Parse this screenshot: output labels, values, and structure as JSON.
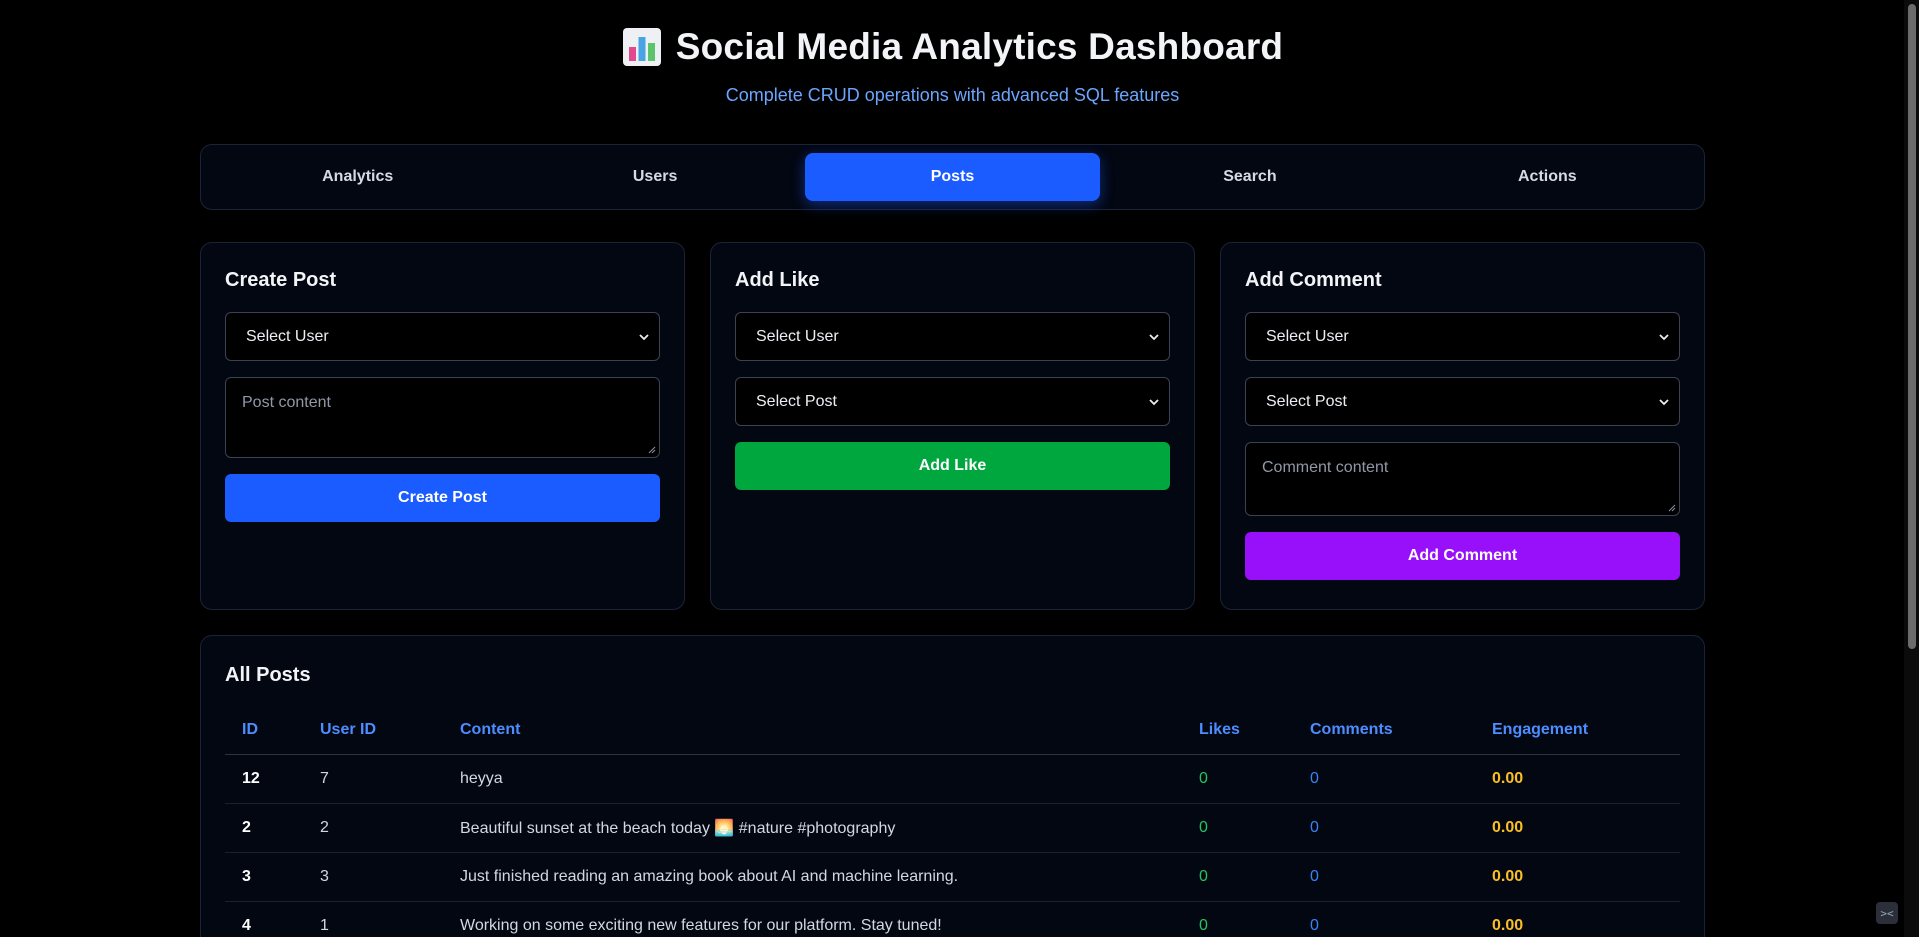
{
  "header": {
    "title": "Social Media Analytics Dashboard",
    "subtitle": "Complete CRUD operations with advanced SQL features",
    "icon": "bar-chart-icon"
  },
  "tabs": [
    {
      "label": "Analytics",
      "active": false
    },
    {
      "label": "Users",
      "active": false
    },
    {
      "label": "Posts",
      "active": true
    },
    {
      "label": "Search",
      "active": false
    },
    {
      "label": "Actions",
      "active": false
    }
  ],
  "create_post": {
    "title": "Create Post",
    "user_select": "Select User",
    "content_placeholder": "Post content",
    "button": "Create Post"
  },
  "add_like": {
    "title": "Add Like",
    "user_select": "Select User",
    "post_select": "Select Post",
    "button": "Add Like"
  },
  "add_comment": {
    "title": "Add Comment",
    "user_select": "Select User",
    "post_select": "Select Post",
    "content_placeholder": "Comment content",
    "button": "Add Comment"
  },
  "posts_table": {
    "title": "All Posts",
    "columns": [
      "ID",
      "User ID",
      "Content",
      "Likes",
      "Comments",
      "Engagement"
    ],
    "rows": [
      {
        "id": "12",
        "user_id": "7",
        "content": "heyya",
        "likes": "0",
        "comments": "0",
        "engagement": "0.00"
      },
      {
        "id": "2",
        "user_id": "2",
        "content": "Beautiful sunset at the beach today 🌅 #nature #photography",
        "likes": "0",
        "comments": "0",
        "engagement": "0.00"
      },
      {
        "id": "3",
        "user_id": "3",
        "content": "Just finished reading an amazing book about AI and machine learning.",
        "likes": "0",
        "comments": "0",
        "engagement": "0.00"
      },
      {
        "id": "4",
        "user_id": "1",
        "content": "Working on some exciting new features for our platform. Stay tuned!",
        "likes": "0",
        "comments": "0",
        "engagement": "0.00"
      }
    ]
  },
  "colors": {
    "primary": "#1a5cff",
    "success": "#00a63e",
    "purple": "#9810fa",
    "header_text": "#4d8dff",
    "engagement": "#fbbf24"
  }
}
